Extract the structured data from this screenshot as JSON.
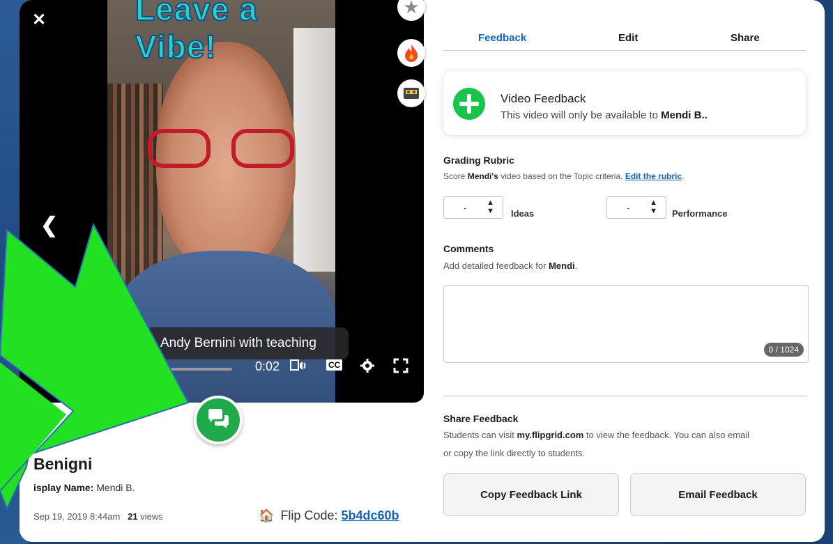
{
  "video": {
    "banner": "Leave a Vibe!",
    "caption": "Andy Bernini with teaching",
    "time": "0:02",
    "cc_label": "CC",
    "close_icon": "close-icon",
    "prev_icon": "chevron-left-icon"
  },
  "side_icons": [
    "star-icon",
    "flame-icon",
    "cassette-icon"
  ],
  "student": {
    "name": "Benigni",
    "display_name_label": "isplay Name:",
    "display_name": "Mendi B.",
    "date": "Sep 19, 2019 8:44am",
    "views_count": "21",
    "views_label": "views",
    "flip_code_label": "Flip Code:",
    "flip_code": "5b4dc60b"
  },
  "tabs": [
    {
      "label": "Feedback",
      "active": true
    },
    {
      "label": "Edit",
      "active": false
    },
    {
      "label": "Share",
      "active": false
    }
  ],
  "video_feedback": {
    "title": "Video Feedback",
    "desc_prefix": "This video will only be available to",
    "desc_name": "Mendi B.."
  },
  "rubric": {
    "title": "Grading Rubric",
    "desc_prefix": "Score",
    "desc_name": "Mendi's",
    "desc_mid": "video based on the Topic criteria.",
    "edit_link": "Edit the rubric",
    "desc_end": ".",
    "criteria": [
      {
        "value": "-",
        "label": "Ideas"
      },
      {
        "value": "-",
        "label": "Performance"
      }
    ]
  },
  "comments": {
    "title": "Comments",
    "desc_prefix": "Add detailed feedback for",
    "desc_name": "Mendi",
    "desc_end": ".",
    "counter": "0 / 1024"
  },
  "share": {
    "title": "Share Feedback",
    "line1_prefix": "Students can visit",
    "line1_link": "my.flipgrid.com",
    "line1_suffix": "to view the feedback. You can also email",
    "line2": "or copy the link directly to students.",
    "copy_button": "Copy Feedback Link",
    "email_button": "Email Feedback"
  },
  "colors": {
    "accent": "#1363b7",
    "green": "#18c44a",
    "arrow_green": "#22e022"
  }
}
